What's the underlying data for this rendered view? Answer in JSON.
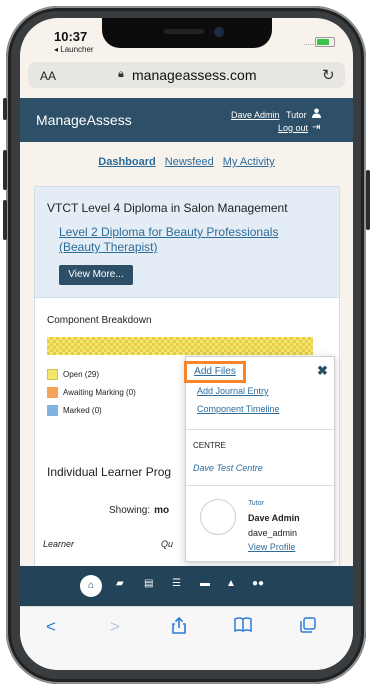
{
  "status_bar": {
    "time": "10:37",
    "back_app": "◂ Launcher",
    "signal": "....."
  },
  "browser": {
    "text_size": "AA",
    "url": "manageassess.com"
  },
  "header": {
    "brand": "ManageAssess",
    "user_name": "Dave Admin",
    "user_role": "Tutor",
    "logout": "Log out"
  },
  "nav": {
    "dashboard": "Dashboard",
    "newsfeed": "Newsfeed",
    "my_activity": "My Activity"
  },
  "qualification": {
    "title": "VTCT Level 4 Diploma in Salon Management",
    "link": "Level 2 Diploma for Beauty Professionals (Beauty Therapist)",
    "view_more": "View More..."
  },
  "component_breakdown": {
    "title": "Component Breakdown",
    "legend": [
      {
        "label": "Open (29)",
        "color": "#f2e66c"
      },
      {
        "label": "Awaiting Marking (0)",
        "color": "#f3a35a"
      },
      {
        "label": "Marked (0)",
        "color": "#7fb3e0"
      }
    ]
  },
  "learner_progress": {
    "title": "Individual Learner Prog",
    "showing_label": "Showing:",
    "showing_value": "mo",
    "col_learner": "Learner",
    "col_qual": "Qu"
  },
  "popover": {
    "add_files": "Add Files",
    "add_journal": "Add Journal Entry",
    "timeline": "Component Timeline",
    "centre_label": "CENTRE",
    "centre_name": "Dave Test Centre",
    "role": "Tutor",
    "name": "Dave Admin",
    "username": "dave_admin",
    "view_profile": "View Profile",
    "highlight_color": "#f5842a"
  },
  "toolbar_icons": [
    "home-icon",
    "book-icon",
    "card-icon",
    "list-icon",
    "folder-icon",
    "graduation-cap-icon",
    "users-icon"
  ],
  "safari_icons": [
    "back-icon",
    "forward-icon",
    "share-icon",
    "bookmarks-icon",
    "tabs-icon"
  ],
  "colors": {
    "header": "#2d4f67",
    "link": "#2d6c9a",
    "toolbar": "#234458"
  }
}
